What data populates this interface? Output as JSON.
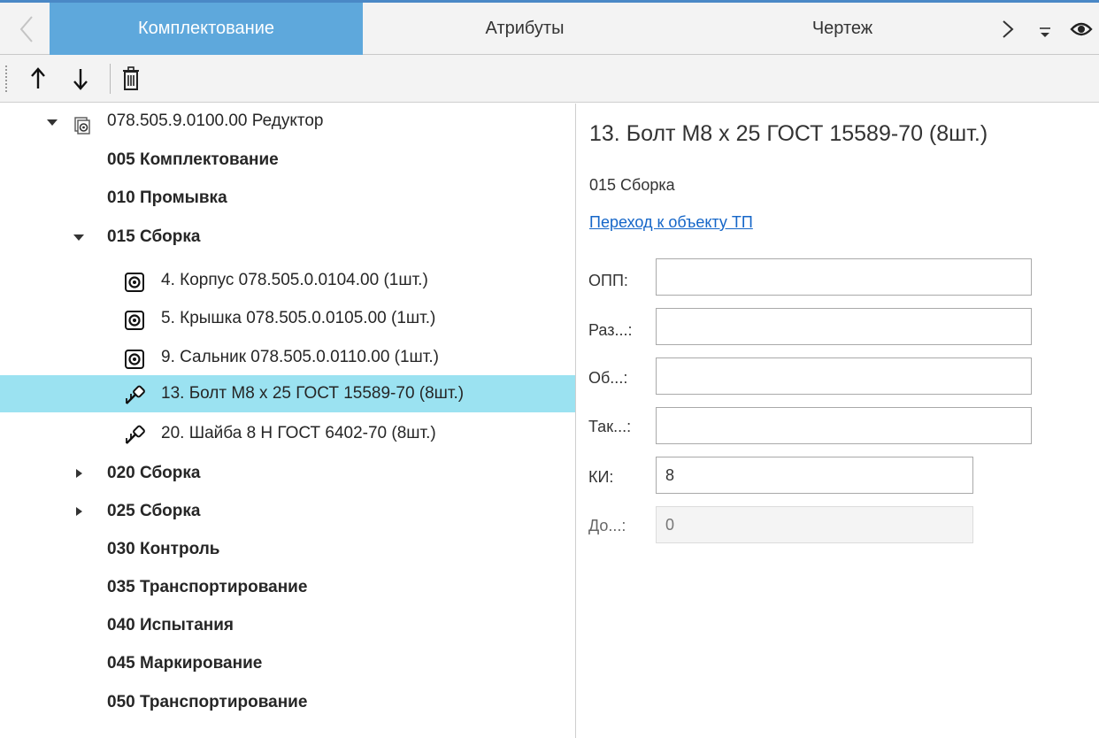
{
  "tabs": [
    {
      "label": "Комплектование",
      "active": true
    },
    {
      "label": "Атрибуты",
      "active": false
    },
    {
      "label": "Чертеж",
      "active": false
    }
  ],
  "tree": {
    "root": {
      "label": "078.505.9.0100.00 Редуктор"
    },
    "items": [
      {
        "label": "005 Комплектование"
      },
      {
        "label": "010 Промывка"
      },
      {
        "label": "015 Сборка"
      },
      {
        "label": "4. Корпус 078.505.0.0104.00 (1шт.)"
      },
      {
        "label": "5. Крышка 078.505.0.0105.00 (1шт.)"
      },
      {
        "label": "9. Сальник 078.505.0.0110.00 (1шт.)"
      },
      {
        "label": "13. Болт М8 х 25 ГОСТ 15589-70 (8шт.)"
      },
      {
        "label": "20. Шайба 8 Н ГОСТ 6402-70 (8шт.)"
      },
      {
        "label": "020 Сборка"
      },
      {
        "label": "025 Сборка"
      },
      {
        "label": "030 Контроль"
      },
      {
        "label": "035 Транспортирование"
      },
      {
        "label": "040 Испытания"
      },
      {
        "label": "045 Маркирование"
      },
      {
        "label": "050 Транспортирование"
      }
    ]
  },
  "details": {
    "title": "13. Болт М8 х 25 ГОСТ 15589-70 (8шт.)",
    "operation": "015 Сборка",
    "link": "Переход к объекту ТП",
    "fields": [
      {
        "label": "ОПП:",
        "value": ""
      },
      {
        "label": "Раз...:",
        "value": ""
      },
      {
        "label": "Об...:",
        "value": ""
      },
      {
        "label": "Так...:",
        "value": ""
      },
      {
        "label": "КИ:",
        "value": "8"
      },
      {
        "label": "До...:",
        "value": "0"
      }
    ]
  },
  "colors": {
    "accent": "#5ea8dc",
    "selection": "#9be2f1",
    "link": "#1566c8"
  }
}
